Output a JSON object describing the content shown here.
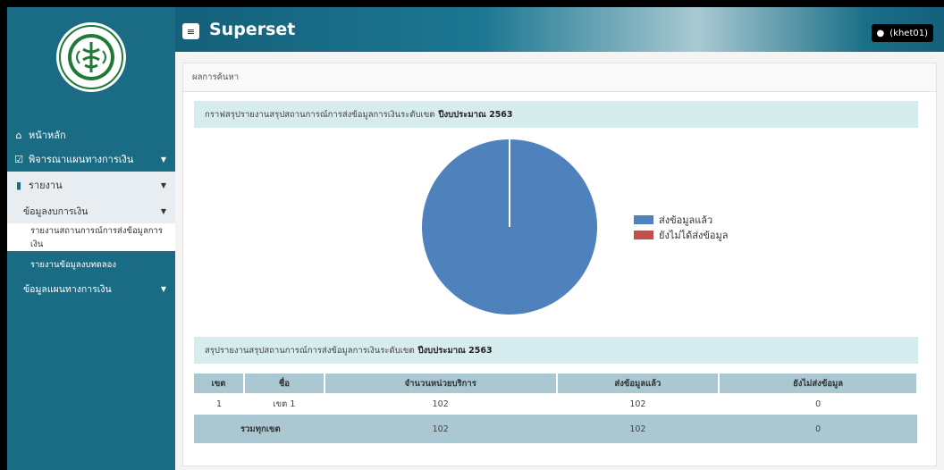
{
  "sidebar": {
    "items": [
      {
        "label": "หน้าหลัก",
        "icon": "home-icon"
      },
      {
        "label": "พิจารณาแผนทางการเงิน",
        "icon": "check-square-icon"
      },
      {
        "label": "รายงาน",
        "icon": "file-icon"
      },
      {
        "label": "ข้อมูลงบการเงิน"
      },
      {
        "label": "รายงานสถานการณ์การส่งข้อมูลการเงิน"
      },
      {
        "label": "รายงานข้อมูลงบทดลอง"
      },
      {
        "label": "ข้อมูลแผนทางการเงิน"
      }
    ]
  },
  "header": {
    "brand": "Superset",
    "user": "(khet01)"
  },
  "panel": {
    "title": "ผลการค้นหา",
    "chart_title": "กราฟสรุปรายงานสรุปสถานการณ์การส่งข้อมูลการเงินระดับเขต",
    "table_title": "สรุปรายงานสรุปสถานการณ์การส่งข้อมูลการเงินระดับเขต",
    "fiscal_year": "ปีงบประมาณ 2563"
  },
  "chart_data": {
    "type": "pie",
    "labels": [
      "ส่งข้อมูลแล้ว",
      "ยังไม่ได้ส่งข้อมูล"
    ],
    "values": [
      102,
      0
    ],
    "colors": [
      "#4f81bd",
      "#c0504d"
    ],
    "legend_position": "right"
  },
  "table": {
    "headers": [
      "เขต",
      "ชื่อ",
      "จำนวนหน่วยบริการ",
      "ส่งข้อมูลแล้ว",
      "ยังไม่ส่งข้อมูล"
    ],
    "rows": [
      [
        "1",
        "เขต 1",
        "102",
        "102",
        "0"
      ]
    ],
    "total": {
      "label": "รวมทุกเขต",
      "units": "102",
      "sent": "102",
      "not_sent": "0"
    }
  }
}
